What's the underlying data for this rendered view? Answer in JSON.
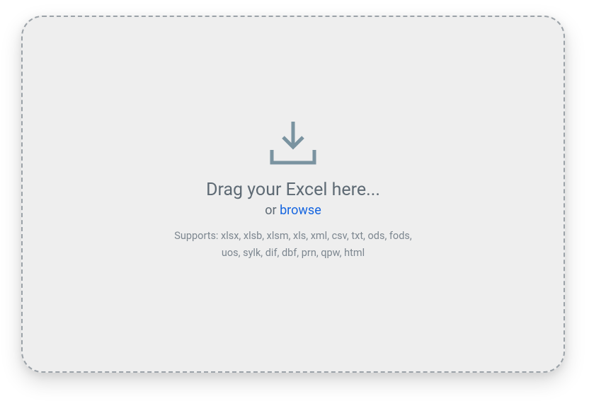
{
  "dropzone": {
    "main_text": "Drag your Excel here...",
    "or_text": "or ",
    "browse_label": "browse",
    "supports_text": "Supports: xlsx, xlsb, xlsm, xls, xml, csv, txt, ods, fods, uos, sylk, dif, dbf, prn, qpw, html"
  }
}
